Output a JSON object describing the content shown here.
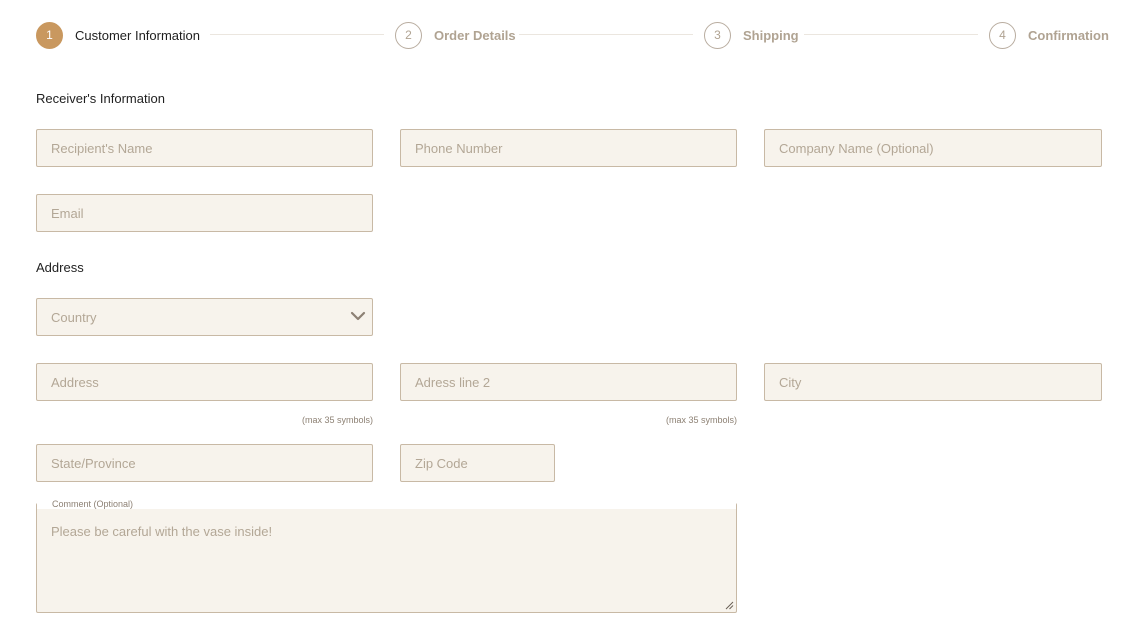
{
  "stepper": {
    "steps": [
      {
        "number": "1",
        "label": "Customer Information",
        "active": true
      },
      {
        "number": "2",
        "label": "Order Details",
        "active": false
      },
      {
        "number": "3",
        "label": "Shipping",
        "active": false
      },
      {
        "number": "4",
        "label": "Confirmation",
        "active": false
      }
    ]
  },
  "receiver": {
    "title": "Receiver's Information",
    "name_placeholder": "Recipient's Name",
    "phone_placeholder": "Phone Number",
    "company_placeholder": "Company Name (Optional)",
    "email_placeholder": "Email"
  },
  "address": {
    "title": "Address",
    "country_placeholder": "Country",
    "address_placeholder": "Address",
    "address_hint": "(max 35 symbols)",
    "address2_placeholder": "Adress line 2",
    "address2_hint": "(max 35 symbols)",
    "city_placeholder": "City",
    "state_placeholder": "State/Province",
    "zip_placeholder": "Zip Code"
  },
  "comment": {
    "legend": "Comment (Optional)",
    "text": "Please be careful with the vase inside!"
  },
  "colors": {
    "accent": "#c9985f",
    "field_bg": "#f7f3ec",
    "field_border": "#c8b9a5",
    "muted_text": "#b0a392"
  },
  "icons": {
    "country_dropdown": "chevron-down-icon",
    "textarea_resize": "resize-handle-icon"
  }
}
